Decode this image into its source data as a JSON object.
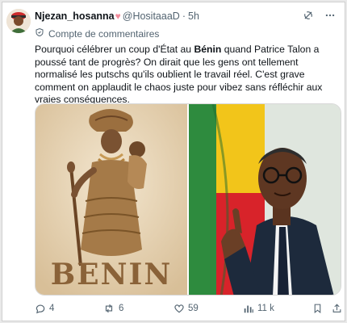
{
  "author": {
    "name": "Njezan_hosanna",
    "handle": "@HositaaaD",
    "dot": "·",
    "time": "5h",
    "heart": "♥"
  },
  "managed_label": "Compte de commentaires",
  "tweet": {
    "line1_pre": "Pourquoi célébrer un coup d'État au ",
    "line1_bold": "Bénin",
    "line1_post": " quand Patrice Talon a poussé tant de progrès? On dirait que les gens ont tellement normalisé les putschs qu'ils oublient le travail réel. C'est grave comment on applaudit le chaos juste pour vibez sans réfléchir aux vraies conséquences."
  },
  "media": {
    "left_caption": "BENIN"
  },
  "actions": {
    "replies": "4",
    "reposts": "6",
    "likes": "59",
    "views": "11 k"
  },
  "icons": [
    "grok-icon",
    "more-icon",
    "managed-account-icon",
    "reply-icon",
    "repost-icon",
    "like-icon",
    "views-icon",
    "bookmark-icon",
    "share-icon"
  ],
  "colors": {
    "text": "#0f1419",
    "secondary": "#536471",
    "heart": "#f28c9c",
    "flag_green": "#2e8b3e",
    "flag_yellow": "#f2c51a",
    "flag_red": "#d8232a"
  }
}
